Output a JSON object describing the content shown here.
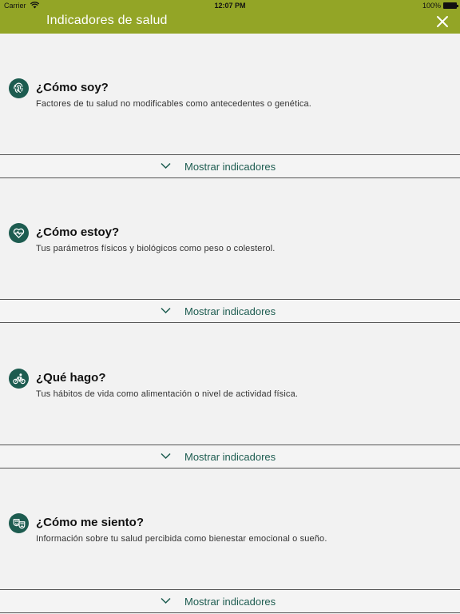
{
  "status_bar": {
    "carrier": "Carrier",
    "time": "12:07 PM",
    "battery": "100%"
  },
  "header": {
    "title": "Indicadores de salud",
    "close_icon": "close-icon",
    "background_color": "#93a526"
  },
  "accent_color": "#1d5c50",
  "sections": [
    {
      "icon": "fingerprint-icon",
      "title": "¿Cómo soy?",
      "description": "Factores de tu salud no modificables como antecedentes o genética.",
      "toggle_label": "Mostrar indicadores"
    },
    {
      "icon": "heart-pulse-icon",
      "title": "¿Cómo estoy?",
      "description": "Tus parámetros físicos y biológicos como peso o colesterol.",
      "toggle_label": "Mostrar indicadores"
    },
    {
      "icon": "bicycle-icon",
      "title": "¿Qué hago?",
      "description": "Tus hábitos de vida como alimentación o nivel de actividad física.",
      "toggle_label": "Mostrar indicadores"
    },
    {
      "icon": "theater-masks-icon",
      "title": "¿Cómo me siento?",
      "description": "Información sobre tu salud percibida como bienestar emocional o sueño.",
      "toggle_label": "Mostrar indicadores"
    }
  ]
}
